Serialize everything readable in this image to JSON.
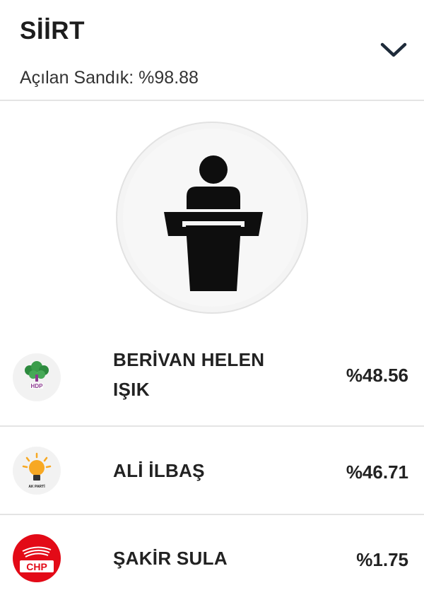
{
  "header": {
    "city": "SİİRT",
    "opened_label": "Açılan Sandık: %98.88"
  },
  "candidates": [
    {
      "name_line1": "BERİVAN HELEN",
      "name_line2": "IŞIK",
      "percent": "%48.56",
      "party_logo": "hdp-logo-icon",
      "logo_text": "HDP"
    },
    {
      "name": "ALİ İLBAŞ",
      "percent": "%46.71",
      "party_logo": "akp-logo-icon",
      "logo_text": "AK PARTİ"
    },
    {
      "name": "ŞAKİR SULA",
      "percent": "%1.75",
      "party_logo": "chp-logo-icon",
      "logo_text": "CHP"
    }
  ],
  "colors": {
    "chp_red": "#e30a17",
    "hdp_green": "#2d8a3e",
    "hdp_purple": "#8b3a8f",
    "akp_yellow": "#f7a823"
  },
  "icons": {
    "expand": "chevron-down-icon",
    "placeholder": "podium-speaker-icon"
  }
}
